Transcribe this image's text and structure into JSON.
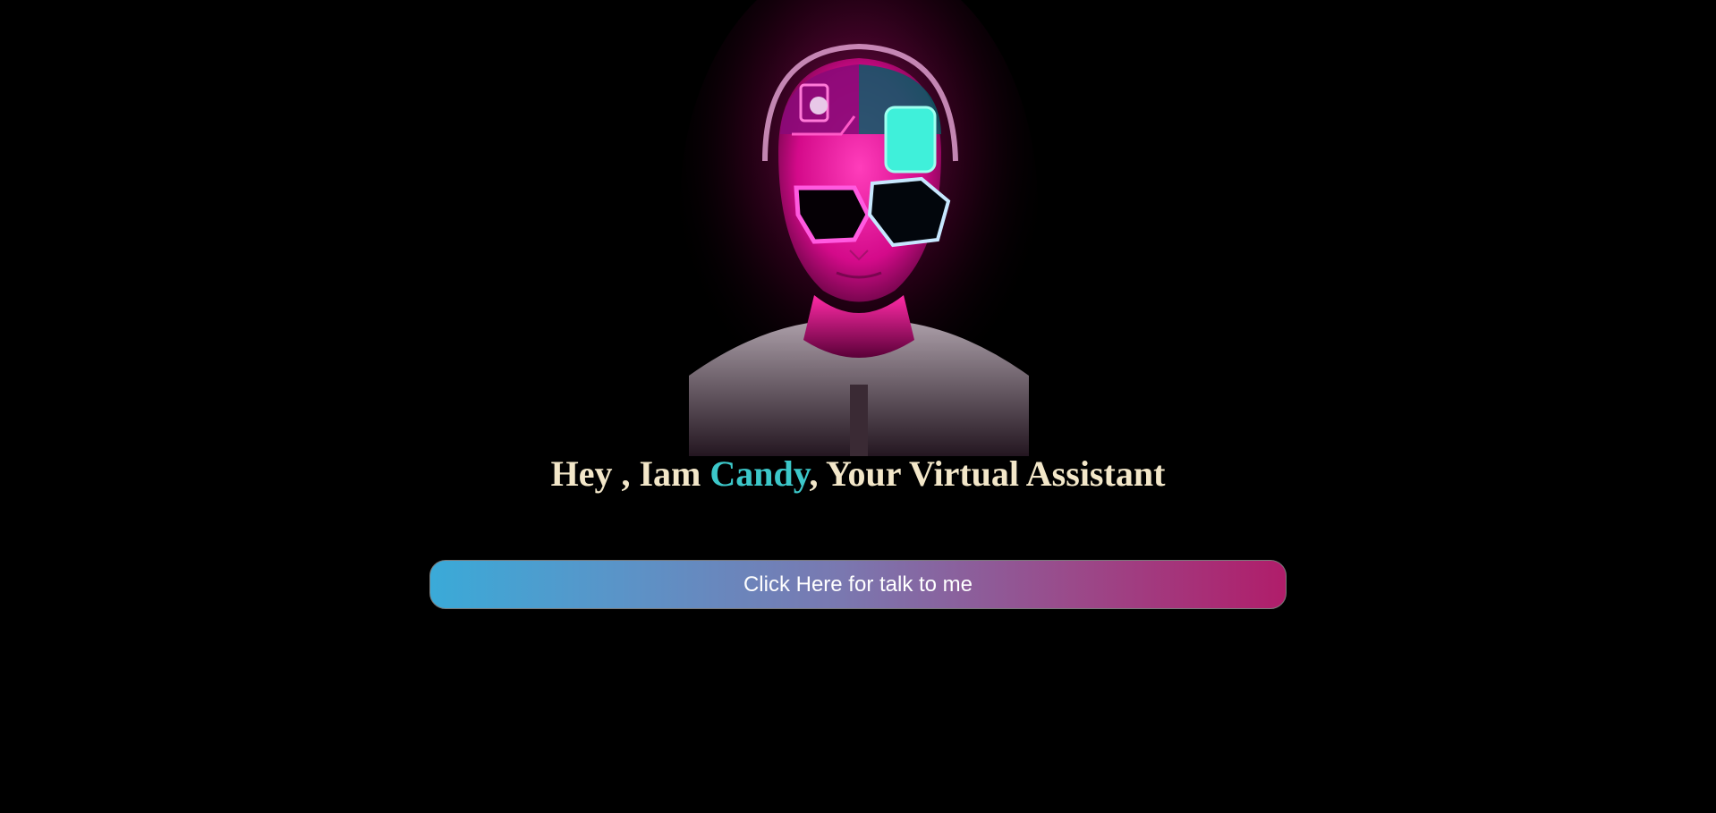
{
  "hero": {
    "greeting_prefix": "Hey , Iam ",
    "assistant_name": "Candy",
    "greeting_suffix": ", Your Virtual Assistant"
  },
  "cta": {
    "label": "Click Here for talk to me"
  },
  "colors": {
    "background": "#000000",
    "heading": "#f3e7c9",
    "name_accent": "#3cc7c9",
    "button_gradient_start": "#3aaad8",
    "button_gradient_end": "#b01d6a"
  },
  "icons": {
    "avatar": "neon-cyber-assistant-avatar"
  }
}
